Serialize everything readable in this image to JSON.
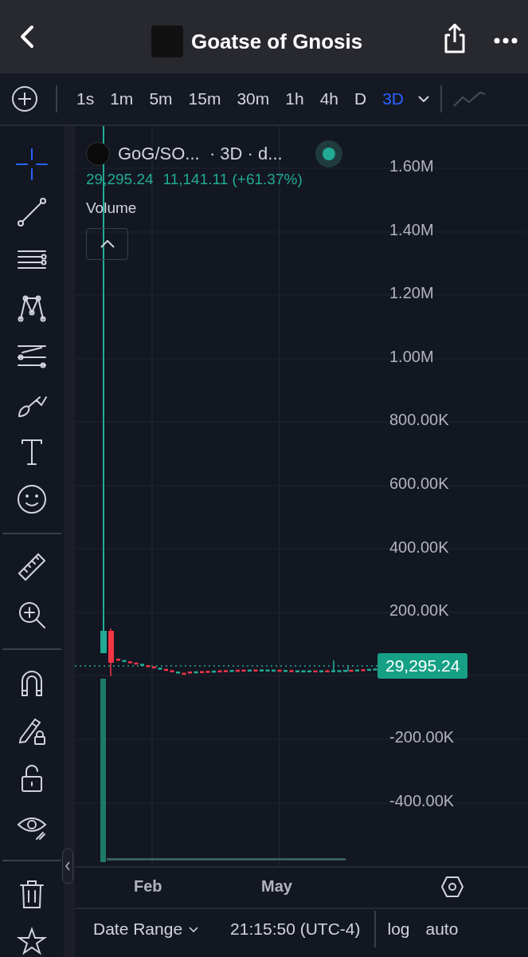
{
  "header": {
    "title": "Goatse of Gnosis"
  },
  "intervals": [
    {
      "label": "1s",
      "selected": false
    },
    {
      "label": "1m",
      "selected": false
    },
    {
      "label": "5m",
      "selected": false
    },
    {
      "label": "15m",
      "selected": false
    },
    {
      "label": "30m",
      "selected": false
    },
    {
      "label": "1h",
      "selected": false
    },
    {
      "label": "4h",
      "selected": false
    },
    {
      "label": "D",
      "selected": false
    },
    {
      "label": "3D",
      "selected": true
    }
  ],
  "tool_groups": [
    [
      {
        "kind": "crosshair",
        "selected": true
      },
      {
        "kind": "line",
        "selected": false
      },
      {
        "kind": "parallel",
        "selected": false
      },
      {
        "kind": "pattern",
        "selected": false
      },
      {
        "kind": "fib",
        "selected": false
      },
      {
        "kind": "brush",
        "selected": false
      },
      {
        "kind": "text",
        "selected": false
      },
      {
        "kind": "emoji",
        "selected": false
      }
    ],
    [
      {
        "kind": "ruler",
        "selected": false
      },
      {
        "kind": "zoom",
        "selected": false
      }
    ],
    [
      {
        "kind": "magnet",
        "selected": false
      },
      {
        "kind": "pencil-lock",
        "selected": false
      },
      {
        "kind": "lock",
        "selected": false
      },
      {
        "kind": "eye",
        "selected": false
      }
    ],
    [
      {
        "kind": "trash",
        "selected": false
      },
      {
        "kind": "star",
        "selected": false
      }
    ]
  ],
  "legend": {
    "symbol": "GoG/SO...  · 3D · d...",
    "price": "29,295.24",
    "change": "11,141.11 (+61.37%)",
    "live": true
  },
  "volume_label": "Volume",
  "price_axis": [
    "1.60M",
    "1.40M",
    "1.20M",
    "1.00M",
    "800.00K",
    "600.00K",
    "400.00K",
    "200.00K",
    "-200.00K",
    "-400.00K"
  ],
  "last_price": "29,295.24",
  "time_axis": [
    "Feb",
    "May"
  ],
  "bottom_bar": {
    "date_range": "Date Range",
    "time": "21:15:50 (UTC-4)",
    "scale_buttons": [
      "log",
      "auto"
    ]
  }
}
